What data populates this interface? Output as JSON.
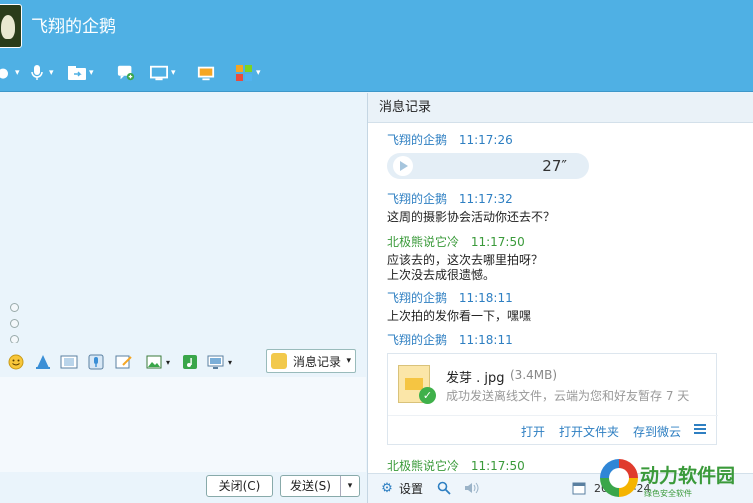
{
  "window": {
    "title": "飞翔的企鹅"
  },
  "toolbar": {
    "items": [
      {
        "icon": "video-icon"
      },
      {
        "icon": "microphone-icon"
      },
      {
        "icon": "file-transfer-icon"
      },
      {
        "icon": "chat-add-icon"
      },
      {
        "icon": "remote-desktop-icon"
      },
      {
        "icon": "screen-share-icon"
      },
      {
        "icon": "apps-icon"
      }
    ]
  },
  "input_tools": {
    "message_log_label": "消息记录"
  },
  "bottom": {
    "close_label": "关闭(C)",
    "send_label": "发送(S)"
  },
  "history": {
    "title": "消息记录",
    "messages": [
      {
        "name": "飞翔的企鹅",
        "time": "11:17:26",
        "kind": "voice",
        "duration": "27″"
      },
      {
        "name": "飞翔的企鹅",
        "time": "11:17:32",
        "text": "这周的摄影协会活动你还去不？"
      },
      {
        "name": "北极熊说它冷",
        "time": "11:17:50",
        "text": "应该去的，这次去哪里拍呀？",
        "text2": "上次没去成很遗憾。"
      },
      {
        "name": "飞翔的企鹅",
        "time": "11:18:11",
        "text": "上次拍的发你看一下，嘿嘿"
      },
      {
        "name": "飞翔的企鹅",
        "time": "11:18:11",
        "kind": "file"
      },
      {
        "name": "北极熊说它冷",
        "time": "11:17:50"
      }
    ],
    "file": {
      "name": "发芽 . jpg",
      "size": "(3.4MB)",
      "desc": "成功发送离线文件，云端为您和好友暂存 7 天",
      "open": "打开",
      "open_folder": "打开文件夹",
      "save_cloud": "存到微云"
    },
    "footer": {
      "settings": "设置",
      "date": "20·······-24"
    }
  },
  "watermark": {
    "text": "动力软件园",
    "sub": "绿色安全软件"
  },
  "colors": {
    "header": "#4fb0e4",
    "name_blue": "#2e7fc2",
    "name_green": "#3a9a3a"
  }
}
